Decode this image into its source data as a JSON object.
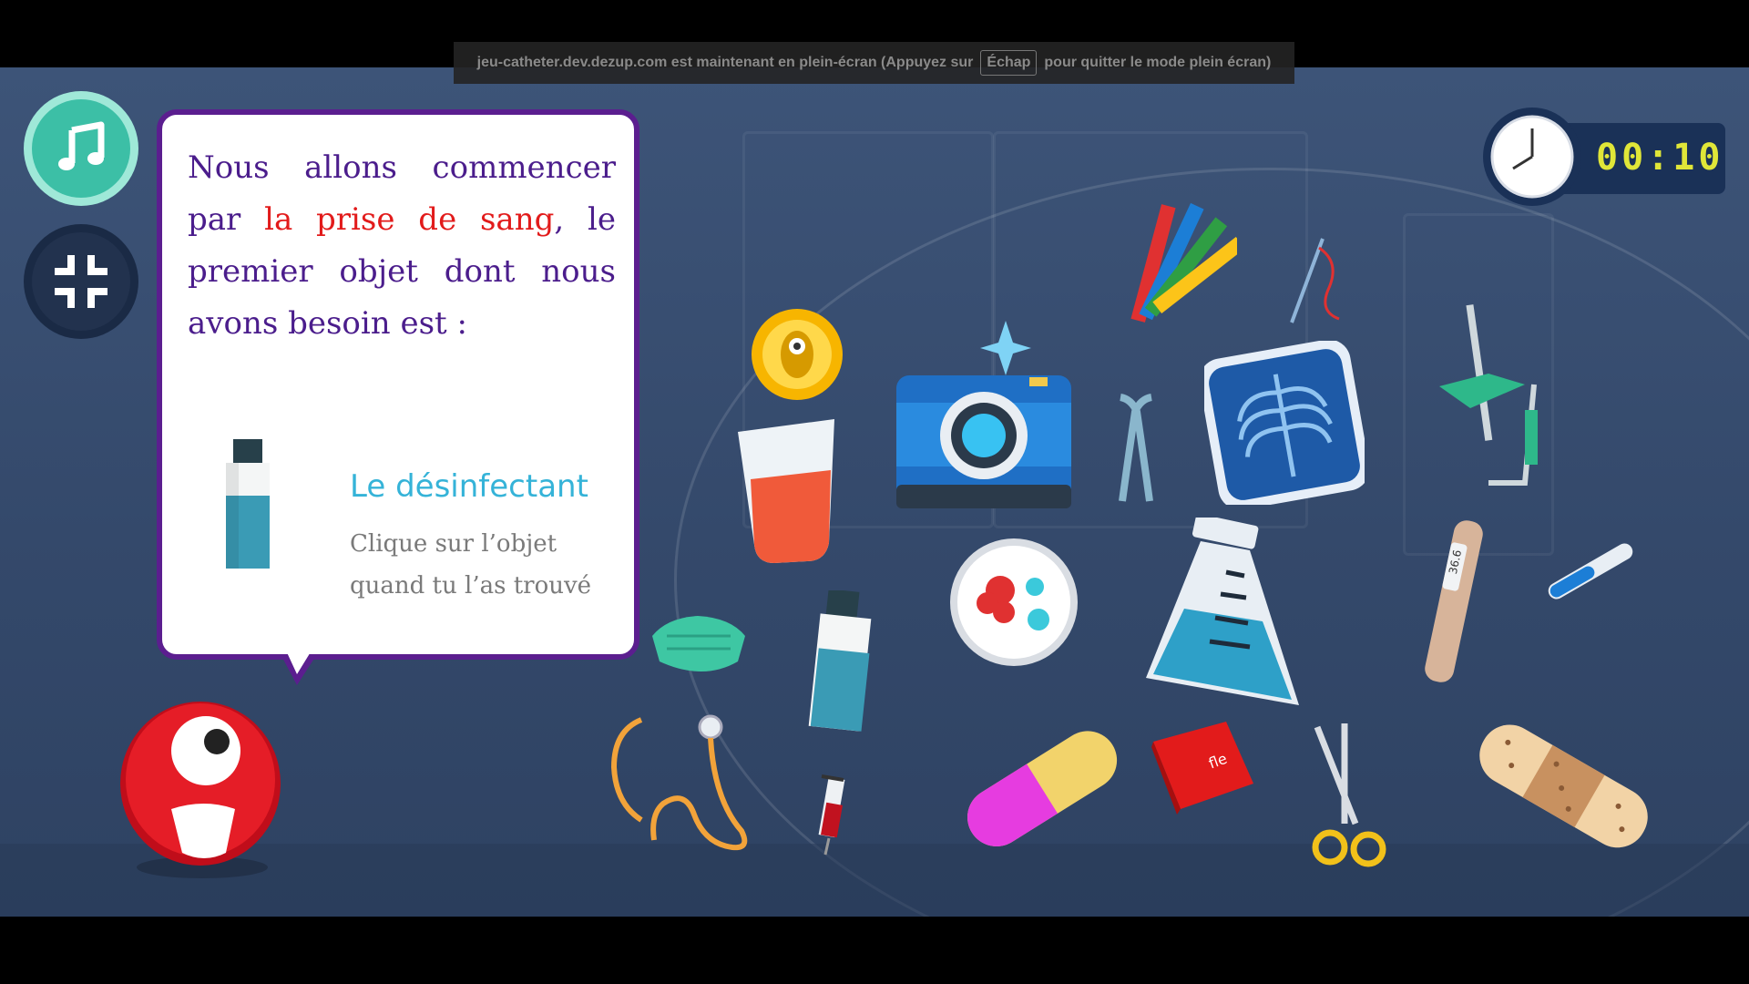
{
  "fullscreen_notice": {
    "prefix": "jeu-catheter.dev.dezup.com est maintenant en plein-écran (Appuyez sur",
    "key": "Échap",
    "suffix": "pour quitter le mode plein écran)"
  },
  "controls": {
    "music_icon": "music-note-icon",
    "exit_fullscreen_icon": "exit-fullscreen-icon"
  },
  "dialog": {
    "text_part1": "Nous allons commencer par ",
    "text_highlight": "la prise de sang",
    "text_part2": ", le premier objet dont nous avons besoin est :",
    "target_name": "Le désinfectant",
    "hint": "Clique sur l’objet quand tu l’as trouvé"
  },
  "timer": {
    "value": "00:10"
  },
  "items": {
    "book_label": "fle",
    "thermometer_label": "36.6"
  },
  "colors": {
    "bubble_border": "#5b1e8f",
    "highlight": "#e21b1b",
    "target": "#35b3d8",
    "timer_digits": "#e0e638"
  }
}
